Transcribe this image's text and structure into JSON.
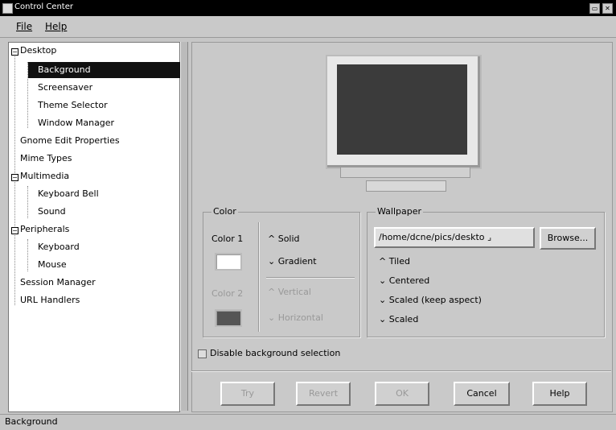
{
  "window": {
    "title": "Control Center",
    "btn_min": "▭",
    "btn_close": "✕"
  },
  "menubar": {
    "file": "File",
    "help": "Help"
  },
  "tree": {
    "items": [
      {
        "label": "Desktop"
      },
      {
        "label": "Background"
      },
      {
        "label": "Screensaver"
      },
      {
        "label": "Theme Selector"
      },
      {
        "label": "Window Manager"
      },
      {
        "label": "Gnome Edit Properties"
      },
      {
        "label": "Mime Types"
      },
      {
        "label": "Multimedia"
      },
      {
        "label": "Keyboard Bell"
      },
      {
        "label": "Sound"
      },
      {
        "label": "Peripherals"
      },
      {
        "label": "Keyboard"
      },
      {
        "label": "Mouse"
      },
      {
        "label": "Session Manager"
      },
      {
        "label": "URL Handlers"
      }
    ],
    "selected": "Background"
  },
  "color_group": {
    "title": "Color",
    "color1": "Color 1",
    "color2": "Color 2",
    "solid": "Solid",
    "gradient": "Gradient",
    "vertical": "Vertical",
    "horizontal": "Horizontal"
  },
  "wallpaper_group": {
    "title": "Wallpaper",
    "path": "/home/dcne/pics/deskto",
    "browse": "Browse...",
    "tiled": "Tiled",
    "centered": "Centered",
    "scaled_keep": "Scaled (keep aspect)",
    "scaled": "Scaled"
  },
  "disable_label": "Disable background selection",
  "buttons": {
    "try": "Try",
    "revert": "Revert",
    "ok": "OK",
    "cancel": "Cancel",
    "help": "Help"
  },
  "status": "Background",
  "colors": {
    "screen": "#3b3b3b",
    "selection": "#111111",
    "swatch2": "#555555"
  }
}
